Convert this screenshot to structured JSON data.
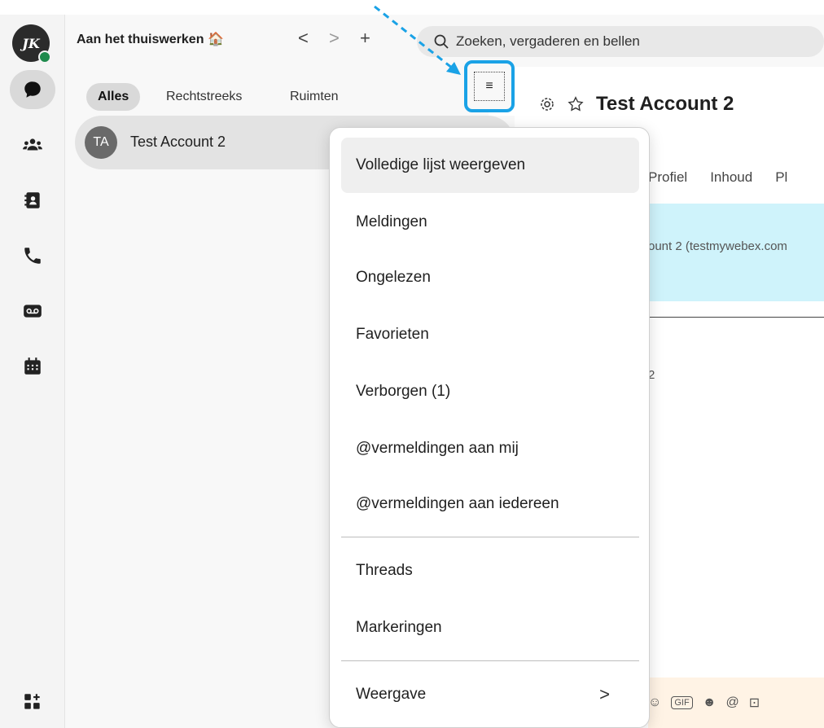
{
  "app": {
    "status_title": "Aan het thuiswerken",
    "status_emoji": "🏠",
    "avatar_initials": "JK"
  },
  "nav": {
    "back": "<",
    "forward": ">",
    "new": "+"
  },
  "search": {
    "placeholder": "Zoeken, vergaderen en bellen"
  },
  "filters": {
    "all": "Alles",
    "direct": "Rechtstreeks",
    "spaces": "Ruimten",
    "filter_glyph": "≡"
  },
  "spaces": [
    {
      "initials": "TA",
      "name": "Test Account 2"
    }
  ],
  "content": {
    "title": "Test Account 2",
    "tabs": [
      "Profiel",
      "Inhoud",
      "Pl"
    ],
    "banner_text": "ount 2  (testmywebex.com",
    "stray_text": "2"
  },
  "menu": {
    "items": [
      "Volledige lijst weergeven",
      "Meldingen",
      "Ongelezen",
      "Favorieten",
      "Verborgen (1)",
      "@vermeldingen aan mij",
      "@vermeldingen aan iedereen",
      "Threads",
      "Markeringen",
      "Weergave"
    ],
    "chevron": ">"
  },
  "colors": {
    "highlight_border": "#1aa2e6",
    "presence": "#1e8a4c",
    "banner": "#cff3fb"
  },
  "icons": [
    "messaging-icon",
    "teams-icon",
    "contacts-icon",
    "calling-icon",
    "voicemail-icon",
    "calendar-icon",
    "add-apps-icon",
    "settings-icon",
    "star-icon",
    "search-icon",
    "filter-icon"
  ]
}
